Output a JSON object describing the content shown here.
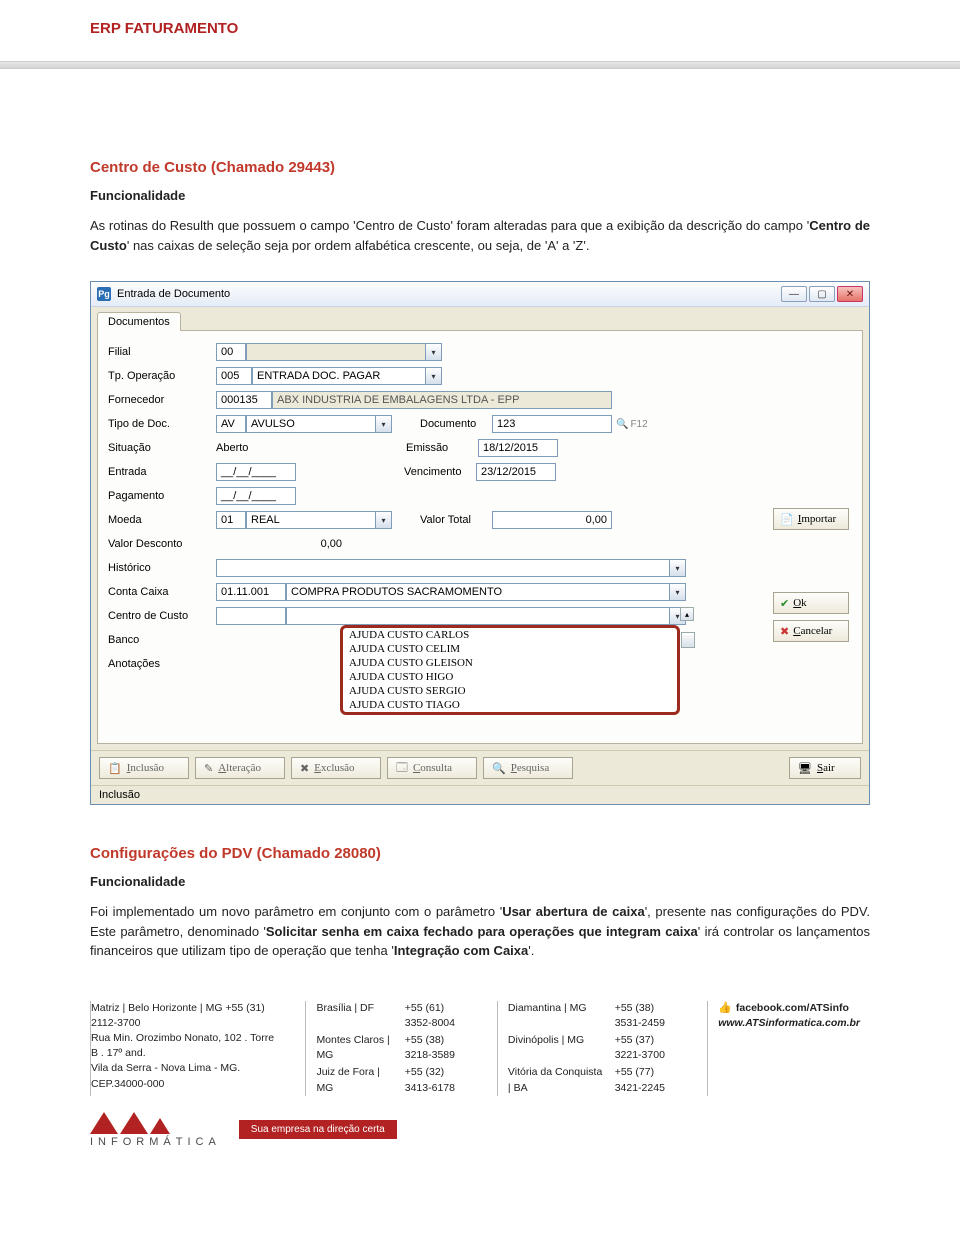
{
  "header": {
    "module": "ERP FATURAMENTO"
  },
  "section1": {
    "title": "Centro de Custo (Chamado 29443)",
    "subtitle": "Funcionalidade",
    "paragraph_parts": {
      "p1": "As rotinas do Resulth que possuem o campo 'Centro de Custo' foram alteradas para que a exibição da descrição do campo '",
      "b1": "Centro de Custo",
      "p2": "' nas caixas de seleção seja por ordem alfabética crescente, ou seja, de 'A' a 'Z'."
    }
  },
  "win": {
    "title": "Entrada de Documento",
    "tab": "Documentos",
    "labels": {
      "filial": "Filial",
      "tp_operacao": "Tp. Operação",
      "fornecedor": "Fornecedor",
      "tipo_doc": "Tipo de Doc.",
      "situacao": "Situação",
      "entrada": "Entrada",
      "pagamento": "Pagamento",
      "moeda": "Moeda",
      "valor_desconto": "Valor Desconto",
      "historico": "Histórico",
      "conta_caixa": "Conta Caixa",
      "centro_custo": "Centro de Custo",
      "banco": "Banco",
      "anotacoes": "Anotações",
      "documento": "Documento",
      "emissao": "Emissão",
      "vencimento": "Vencimento",
      "valor_total": "Valor Total",
      "f12": "F12"
    },
    "values": {
      "filial_code": "00",
      "tp_op_code": "005",
      "tp_op_desc": "ENTRADA DOC. PAGAR",
      "forn_code": "000135",
      "forn_desc": "ABX INDUSTRIA DE EMBALAGENS LTDA - EPP",
      "tipo_doc_code": "AV",
      "tipo_doc_desc": "AVULSO",
      "documento": "123",
      "situacao": "Aberto",
      "emissao": "18/12/2015",
      "entrada": "__/__/____",
      "vencimento": "23/12/2015",
      "pagamento": "__/__/____",
      "moeda_code": "01",
      "moeda_desc": "REAL",
      "valor_total": "0,00",
      "valor_desconto": "0,00",
      "conta_code": "01.11.001",
      "conta_desc": "COMPRA PRODUTOS SACRAMOMENTO"
    },
    "dropdown_options": [
      "AJUDA CUSTO CARLOS",
      "AJUDA CUSTO CELIM",
      "AJUDA CUSTO GLEISON",
      "AJUDA CUSTO HIGO",
      "AJUDA CUSTO SERGIO",
      "AJUDA CUSTO TIAGO"
    ],
    "side_buttons": {
      "importar": "Importar",
      "ok": "Ok",
      "cancelar": "Cancelar"
    },
    "toolbar": {
      "inclusao": "Inclusão",
      "alteracao": "Alteração",
      "exclusao": "Exclusão",
      "consulta": "Consulta",
      "pesquisa": "Pesquisa",
      "sair": "Sair"
    },
    "status": "Inclusão"
  },
  "section2": {
    "title": "Configurações do PDV (Chamado 28080)",
    "subtitle": "Funcionalidade",
    "paragraph_parts": {
      "p1": "Foi implementado um novo parâmetro em conjunto com o parâmetro '",
      "b1": "Usar abertura de caixa",
      "p2": "', presente nas configurações do PDV. Este parâmetro, denominado '",
      "b2": "Solicitar senha em caixa fechado para operações que integram caixa",
      "p3": "' irá controlar os lançamentos financeiros que utilizam tipo de operação que tenha '",
      "b3": "Integração com Caixa",
      "p4": "'."
    }
  },
  "footer": {
    "col1": {
      "l1": "Matriz | Belo Horizonte | MG   +55 (31) 2112-3700",
      "l2": "Rua Min. Orozimbo Nonato, 102 . Torre B . 17º and.",
      "l3": "Vila da Serra - Nova Lima - MG. CEP.34000-000"
    },
    "col2": {
      "a1": "Brasília | DF",
      "b1": "+55 (61) 3352-8004",
      "a2": "Montes Claros | MG",
      "b2": "+55 (38) 3218-3589",
      "a3": "Juiz de Fora | MG",
      "b3": "+55 (32) 3413-6178"
    },
    "col3": {
      "a1": "Diamantina | MG",
      "b1": "+55 (38) 3531-2459",
      "a2": "Divinópolis | MG",
      "b2": "+55 (37) 3221-3700",
      "a3": "Vitória da Conquista | BA",
      "b3": "+55 (77) 3421-2245"
    },
    "social": {
      "fb": "facebook.com/ATSinfo",
      "site": "www.ATSinformatica.com.br"
    },
    "logo_text": "INFORMÁTICA",
    "tagline": "Sua empresa na direção certa"
  }
}
